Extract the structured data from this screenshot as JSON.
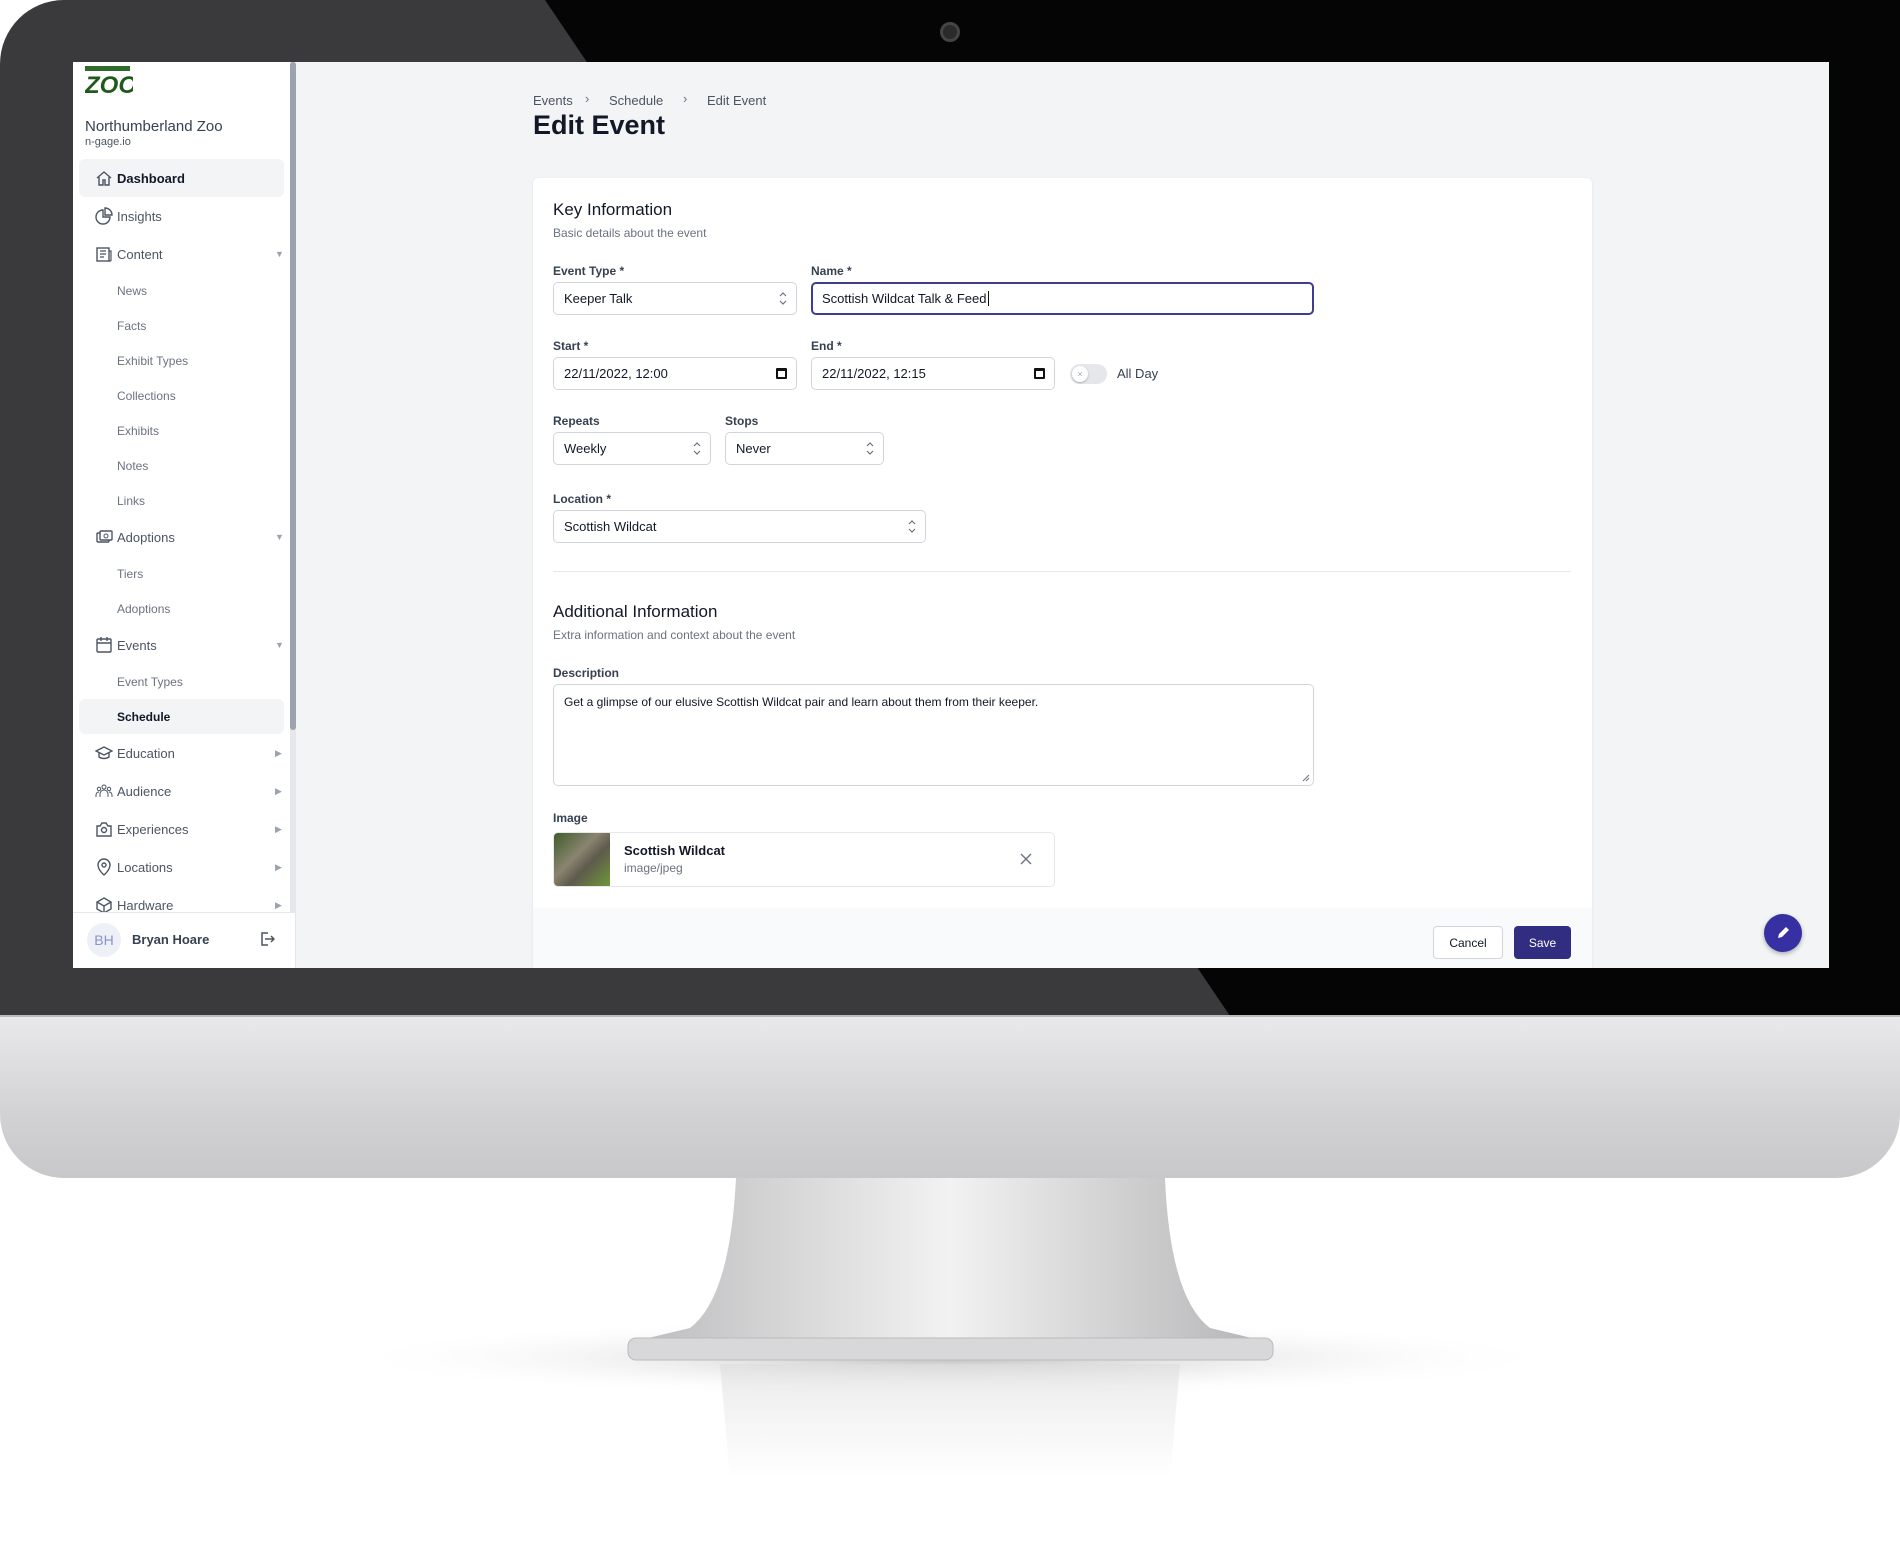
{
  "brand": {
    "logo_text": "Northumberland ZOO",
    "name": "Northumberland Zoo",
    "domain": "n-gage.io"
  },
  "sidebar": {
    "items": [
      {
        "label": "Dashboard",
        "icon": "home-icon",
        "active": true
      },
      {
        "label": "Insights",
        "icon": "pie-chart-icon"
      },
      {
        "label": "Content",
        "icon": "newspaper-icon",
        "expanded": true
      },
      {
        "label": "News",
        "sub": true
      },
      {
        "label": "Facts",
        "sub": true
      },
      {
        "label": "Exhibit Types",
        "sub": true
      },
      {
        "label": "Collections",
        "sub": true
      },
      {
        "label": "Exhibits",
        "sub": true
      },
      {
        "label": "Notes",
        "sub": true
      },
      {
        "label": "Links",
        "sub": true
      },
      {
        "label": "Adoptions",
        "icon": "ticket-icon",
        "expanded": true
      },
      {
        "label": "Tiers",
        "sub": true
      },
      {
        "label": "Adoptions",
        "sub": true
      },
      {
        "label": "Events",
        "icon": "calendar-icon",
        "expanded": true
      },
      {
        "label": "Event Types",
        "sub": true
      },
      {
        "label": "Schedule",
        "sub": true,
        "active": true
      },
      {
        "label": "Education",
        "icon": "graduation-cap-icon"
      },
      {
        "label": "Audience",
        "icon": "users-icon"
      },
      {
        "label": "Experiences",
        "icon": "camera-icon"
      },
      {
        "label": "Locations",
        "icon": "map-pin-icon"
      },
      {
        "label": "Hardware",
        "icon": "cube-icon"
      }
    ],
    "user": {
      "initials": "BH",
      "name": "Bryan Hoare"
    }
  },
  "breadcrumb": [
    "Events",
    "Schedule",
    "Edit Event"
  ],
  "page_title": "Edit Event",
  "key_info": {
    "title": "Key Information",
    "subtitle": "Basic details about the event",
    "event_type": {
      "label": "Event Type *",
      "value": "Keeper Talk"
    },
    "name": {
      "label": "Name *",
      "value": "Scottish Wildcat Talk & Feed"
    },
    "start": {
      "label": "Start *",
      "value": "22/11/2022, 12:00"
    },
    "end": {
      "label": "End *",
      "value": "22/11/2022, 12:15"
    },
    "all_day": {
      "label": "All Day",
      "checked": false
    },
    "repeats": {
      "label": "Repeats",
      "value": "Weekly"
    },
    "stops": {
      "label": "Stops",
      "value": "Never"
    },
    "location": {
      "label": "Location *",
      "value": "Scottish Wildcat"
    }
  },
  "additional_info": {
    "title": "Additional Information",
    "subtitle": "Extra information and context about the event",
    "description": {
      "label": "Description",
      "value": "Get a glimpse of our elusive Scottish Wildcat pair and learn about them from their keeper."
    },
    "image": {
      "label": "Image",
      "name": "Scottish Wildcat",
      "type": "image/jpeg"
    }
  },
  "actions": {
    "cancel": "Cancel",
    "save": "Save"
  },
  "colors": {
    "primary": "#3730a3",
    "focus_border": "#3f3d8f",
    "background": "#f3f4f6"
  }
}
